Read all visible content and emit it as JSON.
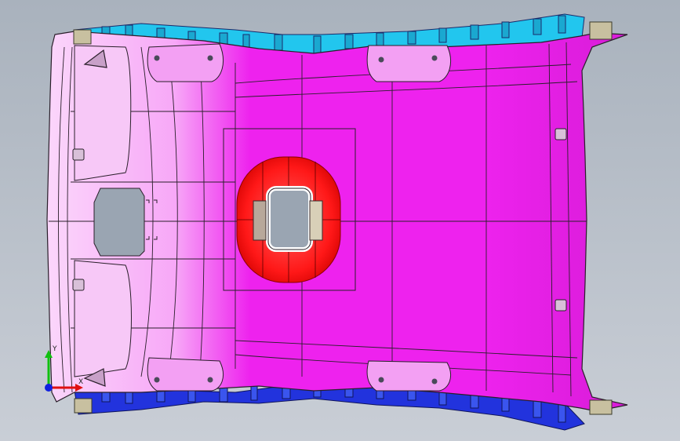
{
  "viewport": {
    "background_top": "#a9b2bd",
    "background_bottom": "#c9ced6"
  },
  "model": {
    "headliner_color": "#ee22ee",
    "headliner_highlight": "#f7b8f7",
    "edge_color": "#2a1f2a",
    "sunroof_color": "#ff2020",
    "sunroof_opening_color": "#9aa5b2",
    "clip_top_color": "#22c6ee",
    "clip_bottom_color": "#2233dd",
    "bracket_color": "#c8c0a0"
  },
  "triad": {
    "x_label": "X",
    "y_label": "Y",
    "x_color": "#e01010",
    "y_color": "#10c010",
    "z_color": "#1020e0"
  }
}
